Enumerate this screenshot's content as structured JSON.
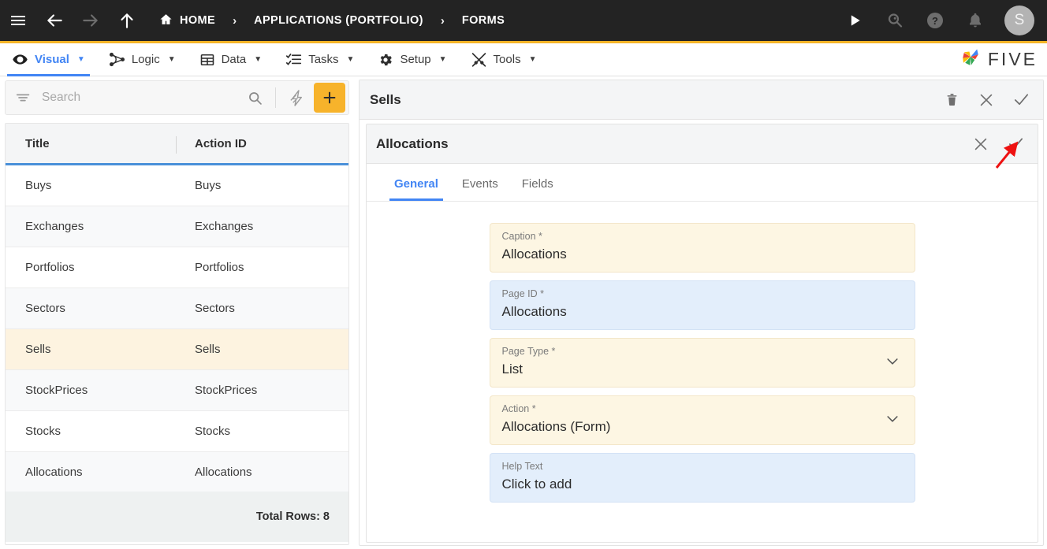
{
  "topbar": {
    "menu_label": "menu",
    "back_label": "back",
    "forward_label": "forward",
    "up_label": "up",
    "breadcrumbs": [
      {
        "label": "HOME",
        "icon": "home-icon"
      },
      {
        "label": "APPLICATIONS (PORTFOLIO)",
        "icon": ""
      },
      {
        "label": "FORMS",
        "icon": ""
      }
    ],
    "separator": "›",
    "actions": [
      {
        "name": "run-icon",
        "label": "Run"
      },
      {
        "name": "search-magnifier-icon",
        "label": "Search"
      },
      {
        "name": "help-icon",
        "label": "Help"
      },
      {
        "name": "notifications-bell-icon",
        "label": "Notifications"
      }
    ],
    "avatar_initial": "S",
    "accent_underline_color": "#f5b427",
    "background_color": "#232323"
  },
  "menubar": {
    "items": [
      {
        "label": "Visual",
        "icon": "eye-icon",
        "caret": "▼",
        "active": true
      },
      {
        "label": "Logic",
        "icon": "nodes-icon",
        "caret": "▼",
        "active": false
      },
      {
        "label": "Data",
        "icon": "table-icon",
        "caret": "▼",
        "active": false
      },
      {
        "label": "Tasks",
        "icon": "checklist-icon",
        "caret": "▼",
        "active": false
      },
      {
        "label": "Setup",
        "icon": "gear-icon",
        "caret": "▼",
        "active": false
      },
      {
        "label": "Tools",
        "icon": "tools-icon",
        "caret": "▼",
        "active": false
      }
    ],
    "brand": "FIVE",
    "active_color": "#4285f4"
  },
  "left_panel": {
    "search": {
      "placeholder": "Search",
      "value": ""
    },
    "filter_icon": "filter-icon",
    "search_icon": "search-icon",
    "bolt_icon": "lightning-bolt-icon",
    "add_label": "+",
    "grid": {
      "columns": [
        "Title",
        "Action ID"
      ],
      "rows": [
        {
          "title": "Buys",
          "action_id": "Buys",
          "selected": false
        },
        {
          "title": "Exchanges",
          "action_id": "Exchanges",
          "selected": false
        },
        {
          "title": "Portfolios",
          "action_id": "Portfolios",
          "selected": false
        },
        {
          "title": "Sectors",
          "action_id": "Sectors",
          "selected": false
        },
        {
          "title": "Sells",
          "action_id": "Sells",
          "selected": true
        },
        {
          "title": "StockPrices",
          "action_id": "StockPrices",
          "selected": false
        },
        {
          "title": "Stocks",
          "action_id": "Stocks",
          "selected": false
        },
        {
          "title": "Allocations",
          "action_id": "Allocations",
          "selected": false
        }
      ],
      "footer": "Total Rows: 8",
      "header_underline_color": "#4a90d9",
      "selected_row_color": "#fdf3e0"
    }
  },
  "right_panel": {
    "outer": {
      "title": "Sells",
      "actions": [
        {
          "name": "delete-icon",
          "label": "Delete"
        },
        {
          "name": "close-icon",
          "label": "Cancel"
        },
        {
          "name": "check-icon",
          "label": "Save"
        }
      ]
    },
    "inner": {
      "title": "Allocations",
      "actions": [
        {
          "name": "close-icon",
          "label": "Cancel"
        },
        {
          "name": "check-icon",
          "label": "Save"
        }
      ],
      "tabs": [
        {
          "label": "General",
          "active": true
        },
        {
          "label": "Events",
          "active": false
        },
        {
          "label": "Fields",
          "active": false
        }
      ],
      "fields": [
        {
          "label": "Caption *",
          "value": "Allocations",
          "style": "yellow",
          "chevron": false,
          "name": "caption-field"
        },
        {
          "label": "Page ID *",
          "value": "Allocations",
          "style": "blue",
          "chevron": false,
          "name": "page-id-field"
        },
        {
          "label": "Page Type *",
          "value": "List",
          "style": "yellow",
          "chevron": true,
          "name": "page-type-field"
        },
        {
          "label": "Action *",
          "value": "Allocations (Form)",
          "style": "yellow",
          "chevron": true,
          "name": "action-field"
        },
        {
          "label": "Help Text",
          "value": "Click to add",
          "style": "blue",
          "chevron": false,
          "name": "help-text-field"
        }
      ]
    }
  },
  "annotation": {
    "arrow_color": "#ee1111",
    "points_to": "check-icon"
  }
}
